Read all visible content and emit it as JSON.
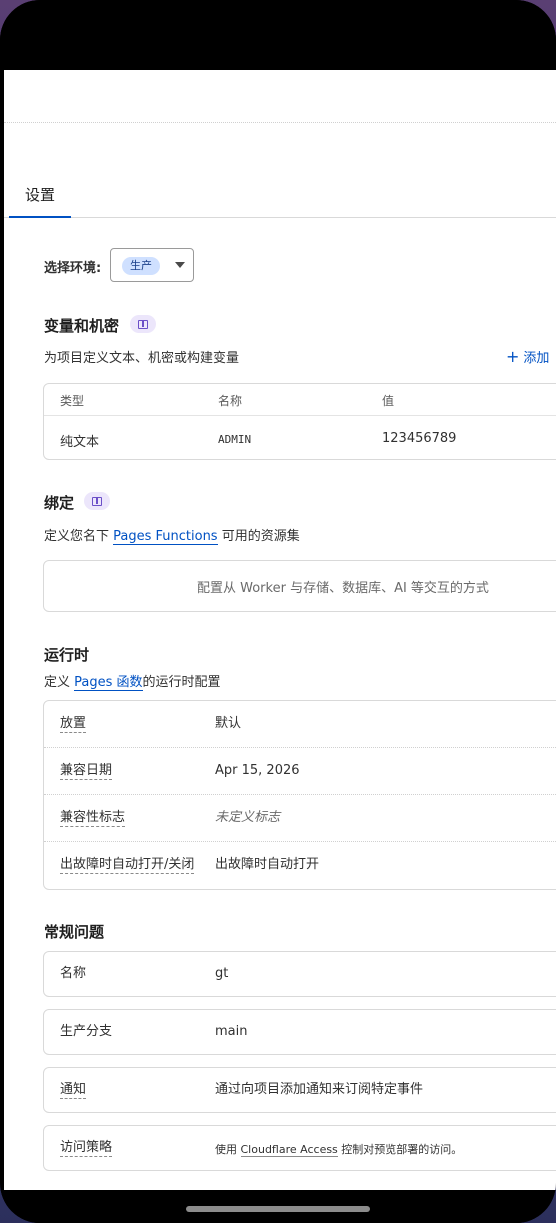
{
  "tabs": {
    "settings": "设置"
  },
  "env": {
    "label": "选择环境:",
    "selected": "生产"
  },
  "variables": {
    "title": "变量和机密",
    "description": "为项目定义文本、机密或构建变量",
    "add_label": "添加",
    "columns": [
      "类型",
      "名称",
      "值"
    ],
    "rows": [
      {
        "type": "纯文本",
        "name": "ADMIN",
        "value": "123456789"
      }
    ]
  },
  "bindings": {
    "title": "绑定",
    "desc_prefix": "定义您名下 ",
    "desc_link": "Pages Functions",
    "desc_suffix": " 可用的资源集",
    "empty": "配置从 Worker 与存储、数据库、AI 等交互的方式"
  },
  "runtime": {
    "title": "运行时",
    "desc_prefix": "定义 ",
    "desc_link": "Pages 函数",
    "desc_suffix": "的运行时配置",
    "rows": [
      {
        "key": "放置",
        "value": "默认"
      },
      {
        "key": "兼容日期",
        "value": "Apr 15, 2026"
      },
      {
        "key": "兼容性标志",
        "value": "未定义标志"
      },
      {
        "key": "出故障时自动打开/关闭",
        "value": "出故障时自动打开"
      }
    ]
  },
  "general": {
    "title": "常规问题",
    "rows": [
      {
        "key": "名称",
        "value": "gt"
      },
      {
        "key": "生产分支",
        "value": "main"
      },
      {
        "key": "通知",
        "value": "通过向项目添加通知来订阅特定事件"
      },
      {
        "key": "访问策略",
        "value_prefix": "使用 ",
        "value_link": "Cloudflare Access",
        "value_suffix": " 控制对预览部署的访问。"
      }
    ]
  }
}
